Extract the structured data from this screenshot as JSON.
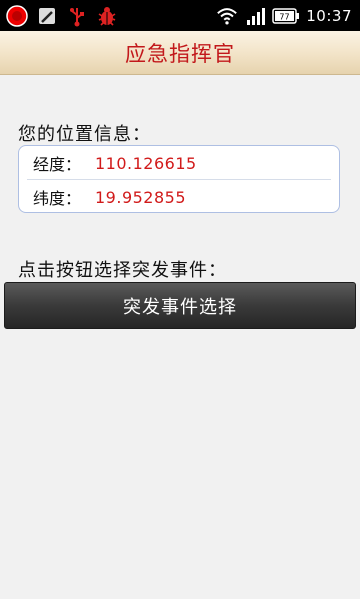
{
  "status_bar": {
    "time": "10:37",
    "battery": "77",
    "icons": [
      "record-icon",
      "sim-icon",
      "usb-icon",
      "bug-icon",
      "wifi-icon",
      "signal-icon",
      "battery-icon"
    ]
  },
  "app": {
    "title": "应急指挥官"
  },
  "location": {
    "section_label": "您的位置信息：",
    "longitude_label": "经度：",
    "longitude_value": "110.126615",
    "latitude_label": "纬度：",
    "latitude_value": "19.952855"
  },
  "event": {
    "section_label": "点击按钮选择突发事件：",
    "button_label": "突发事件选择"
  },
  "colors": {
    "title_text": "#c2181b",
    "value_text": "#d11a1a",
    "background": "#f1f1f1",
    "button_bg": "#3a3a3a",
    "card_border": "#aebfe3"
  }
}
